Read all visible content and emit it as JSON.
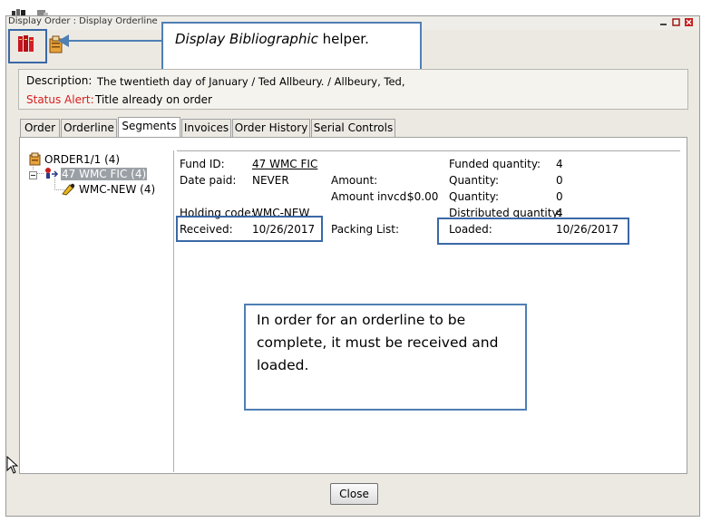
{
  "window": {
    "title": "Display Order : Display Orderline"
  },
  "description": {
    "label": "Description:",
    "value": "The twentieth day of January / Ted Allbeury. / Allbeury, Ted,"
  },
  "status_alert": {
    "label": "Status Alert:",
    "value": "Title already on order"
  },
  "tabs": [
    {
      "label": "Order"
    },
    {
      "label": "Orderline"
    },
    {
      "label": "Segments"
    },
    {
      "label": "Invoices"
    },
    {
      "label": "Order History"
    },
    {
      "label": "Serial Controls"
    }
  ],
  "active_tab": "Segments",
  "tree": {
    "root": "ORDER1/1 (4)",
    "segment": "47 WMC FIC (4)",
    "holding": "WMC-NEW (4)"
  },
  "details": {
    "fund_id_label": "Fund ID:",
    "fund_id_value": "47 WMC FIC",
    "date_paid_label": "Date paid:",
    "date_paid_value": "NEVER",
    "amount_label": "Amount:",
    "amount_invcd_label": "Amount invcd:",
    "amount_invcd_value": "$0.00",
    "holding_code_label": "Holding code:",
    "holding_code_value": "WMC-NEW",
    "received_label": "Received:",
    "received_value": "10/26/2017",
    "packing_list_label": "Packing List:",
    "funded_qty_label": "Funded quantity:",
    "funded_qty_value": "4",
    "quantity1_label": "Quantity:",
    "quantity1_value": "0",
    "quantity2_label": "Quantity:",
    "quantity2_value": "0",
    "distributed_qty_label": "Distributed quantity:",
    "distributed_qty_value": "4",
    "loaded_label": "Loaded:",
    "loaded_value": "10/26/2017"
  },
  "callouts": {
    "helper_italic": "Display Bibliographic",
    "helper_rest": " helper.",
    "note": "In order for an orderline to be complete, it must be received and loaded."
  },
  "buttons": {
    "close": "Close"
  },
  "icons": {
    "bib_helper": "books-icon",
    "order_helper": "order-clipboard-icon"
  },
  "colors": {
    "status_alert": "#d61e1e",
    "callout_border": "#4f7fb4",
    "selected_node": "#9aa0a6"
  }
}
